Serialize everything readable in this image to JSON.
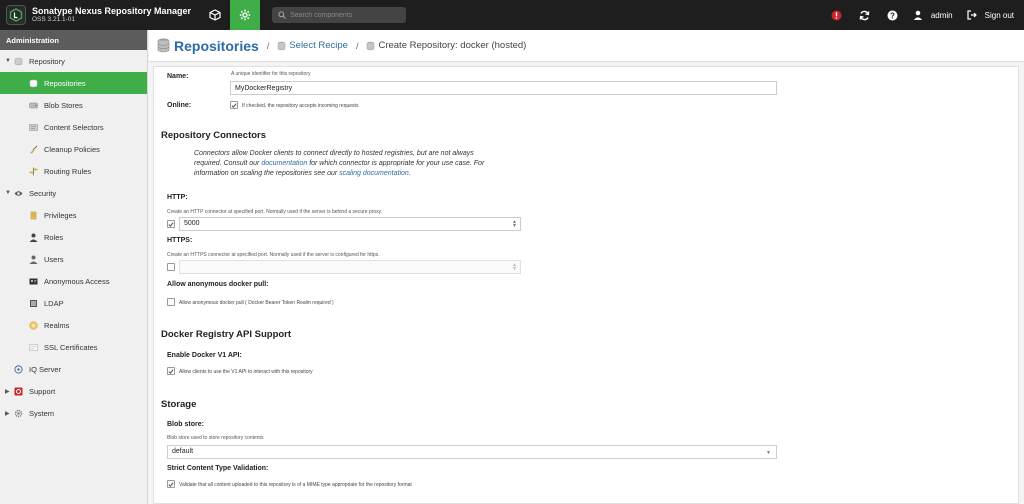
{
  "app": {
    "name": "Sonatype Nexus Repository Manager",
    "version": "OSS 3.21.1-01"
  },
  "topbar": {
    "search_placeholder": "Search components",
    "user": "admin",
    "signout": "Sign out",
    "icons": [
      "browse-cube-icon",
      "admin-gear-icon",
      "alert-icon",
      "refresh-icon",
      "help-icon",
      "user-icon",
      "signout-icon"
    ],
    "accent": "#3fae49",
    "alert_color": "#c9252c"
  },
  "sidebar": {
    "header": "Administration",
    "items": [
      {
        "label": "Repository",
        "level": 0,
        "expanded": true,
        "icon": "database-icon"
      },
      {
        "label": "Repositories",
        "level": 1,
        "active": true,
        "icon": "database-icon"
      },
      {
        "label": "Blob Stores",
        "level": 1,
        "icon": "hdd-icon"
      },
      {
        "label": "Content Selectors",
        "level": 1,
        "icon": "layers-icon"
      },
      {
        "label": "Cleanup Policies",
        "level": 1,
        "icon": "broom-icon"
      },
      {
        "label": "Routing Rules",
        "level": 1,
        "icon": "route-icon"
      },
      {
        "label": "Security",
        "level": 0,
        "expanded": true,
        "icon": "eye-icon"
      },
      {
        "label": "Privileges",
        "level": 1,
        "icon": "medal-icon"
      },
      {
        "label": "Roles",
        "level": 1,
        "icon": "user-tie-icon"
      },
      {
        "label": "Users",
        "level": 1,
        "icon": "users-icon"
      },
      {
        "label": "Anonymous Access",
        "level": 1,
        "icon": "id-card-icon"
      },
      {
        "label": "LDAP",
        "level": 1,
        "icon": "book-icon"
      },
      {
        "label": "Realms",
        "level": 1,
        "icon": "badge-icon"
      },
      {
        "label": "SSL Certificates",
        "level": 1,
        "icon": "certificate-icon"
      },
      {
        "label": "IQ Server",
        "level": 0,
        "icon": "iq-icon"
      },
      {
        "label": "Support",
        "level": 0,
        "expanded": false,
        "icon": "lifebuoy-icon"
      },
      {
        "label": "System",
        "level": 0,
        "expanded": false,
        "icon": "gears-icon"
      }
    ]
  },
  "breadcrumb": {
    "title": "Repositories",
    "separator": "/",
    "link": "Select Recipe",
    "current": "Create Repository: docker (hosted)"
  },
  "form": {
    "name": {
      "label": "Name:",
      "help": "A unique identifier for this repository",
      "value": "MyDockerRegistry"
    },
    "online": {
      "label": "Online:",
      "help": "If checked, the repository accepts incoming requests",
      "checked": true
    },
    "connectors": {
      "title": "Repository Connectors",
      "note_1": "Connectors allow Docker clients to connect directly to hosted registries, but are not always required. Consult our ",
      "note_link_1": "documentation",
      "note_2": " for which connector is appropriate for your use case. For information on scaling the repositories see our ",
      "note_link_2": "scaling documentation",
      "note_3": ".",
      "http": {
        "label": "HTTP:",
        "help": "Create an HTTP connector at specified port. Normally used if the server is behind a secure proxy.",
        "checked": true,
        "value": "5000"
      },
      "https": {
        "label": "HTTPS:",
        "help": "Create an HTTPS connector at specified port. Normally used if the server is configured for https.",
        "checked": false,
        "value": ""
      },
      "anon": {
        "label": "Allow anonymous docker pull:",
        "help": "Allow anonymous docker pull ( Docker Bearer Token Realm required )",
        "checked": false
      }
    },
    "api": {
      "title": "Docker Registry API Support",
      "v1_label": "Enable Docker V1 API:",
      "v1_help": "Allow clients to use the V1 API to interact with this repository",
      "checked": true
    },
    "storage": {
      "title": "Storage",
      "blob_label": "Blob store:",
      "blob_help": "Blob store used to store repository contents",
      "blob_value": "default",
      "strict_label": "Strict Content Type Validation:",
      "strict_help": "Validate that all content uploaded to this repository is of a MIME type appropriate for the repository format",
      "strict_checked": true
    }
  }
}
